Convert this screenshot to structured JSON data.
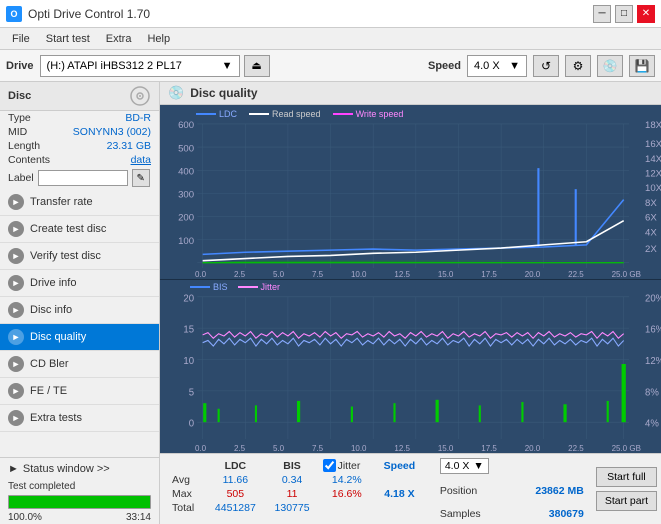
{
  "titleBar": {
    "title": "Opti Drive Control 1.70",
    "minimize": "─",
    "maximize": "□",
    "close": "✕"
  },
  "menu": {
    "items": [
      "File",
      "Start test",
      "Extra",
      "Help"
    ]
  },
  "drive": {
    "label": "Drive",
    "driveValue": "(H:)  ATAPI iHBS312  2 PL17",
    "speedLabel": "Speed",
    "speedValue": "4.0 X"
  },
  "disc": {
    "title": "Disc",
    "typeLabel": "Type",
    "typeValue": "BD-R",
    "midLabel": "MID",
    "midValue": "SONYNN3 (002)",
    "lengthLabel": "Length",
    "lengthValue": "23.31 GB",
    "contentsLabel": "Contents",
    "contentsValue": "data",
    "labelLabel": "Label",
    "labelValue": ""
  },
  "nav": {
    "items": [
      {
        "id": "transfer-rate",
        "label": "Transfer rate",
        "icon": "►"
      },
      {
        "id": "create-test-disc",
        "label": "Create test disc",
        "icon": "►"
      },
      {
        "id": "verify-test-disc",
        "label": "Verify test disc",
        "icon": "►"
      },
      {
        "id": "drive-info",
        "label": "Drive info",
        "icon": "►"
      },
      {
        "id": "disc-info",
        "label": "Disc info",
        "icon": "►"
      },
      {
        "id": "disc-quality",
        "label": "Disc quality",
        "icon": "►",
        "active": true
      },
      {
        "id": "cd-bler",
        "label": "CD Bler",
        "icon": "►"
      },
      {
        "id": "fe-te",
        "label": "FE / TE",
        "icon": "►"
      },
      {
        "id": "extra-tests",
        "label": "Extra tests",
        "icon": "►"
      }
    ]
  },
  "statusWindow": {
    "label": "Status window >>",
    "icon": "►"
  },
  "statusBar": {
    "text": "Test completed",
    "progress": 100,
    "progressText": "100.0%",
    "time": "33:14"
  },
  "discQuality": {
    "title": "Disc quality",
    "chartTopLegend": {
      "ldc": "LDC",
      "read": "Read speed",
      "write": "Write speed"
    },
    "chartBottomLegend": {
      "bis": "BIS",
      "jitter": "Jitter"
    },
    "topYAxisLeft": [
      "600",
      "500",
      "400",
      "300",
      "200",
      "100",
      "0"
    ],
    "topYAxisRight": [
      "18X",
      "16X",
      "14X",
      "12X",
      "10X",
      "8X",
      "6X",
      "4X",
      "2X"
    ],
    "bottomYAxisLeft": [
      "20",
      "15",
      "10",
      "5",
      "0"
    ],
    "bottomYAxisRight": [
      "20%",
      "16%",
      "12%",
      "8%",
      "4%"
    ],
    "xAxisLabels": [
      "0.0",
      "2.5",
      "5.0",
      "7.5",
      "10.0",
      "12.5",
      "15.0",
      "17.5",
      "20.0",
      "22.5",
      "25.0 GB"
    ],
    "stats": {
      "headers": [
        "",
        "LDC",
        "BIS",
        "",
        "Jitter",
        "Speed"
      ],
      "rows": [
        {
          "label": "Avg",
          "ldc": "11.66",
          "bis": "0.34",
          "jitter": "14.2%",
          "jitterCheck": true
        },
        {
          "label": "Max",
          "ldc": "505",
          "bis": "11",
          "jitter": "16.6%",
          "speed": "4.18 X",
          "speedBox": "4.0 X"
        },
        {
          "label": "Total",
          "ldc": "4451287",
          "bis": "130775",
          "jitter": ""
        }
      ],
      "position": {
        "label": "Position",
        "value": "23862 MB"
      },
      "samples": {
        "label": "Samples",
        "value": "380679"
      }
    },
    "startButtons": {
      "startFull": "Start full",
      "startPart": "Start part"
    }
  }
}
